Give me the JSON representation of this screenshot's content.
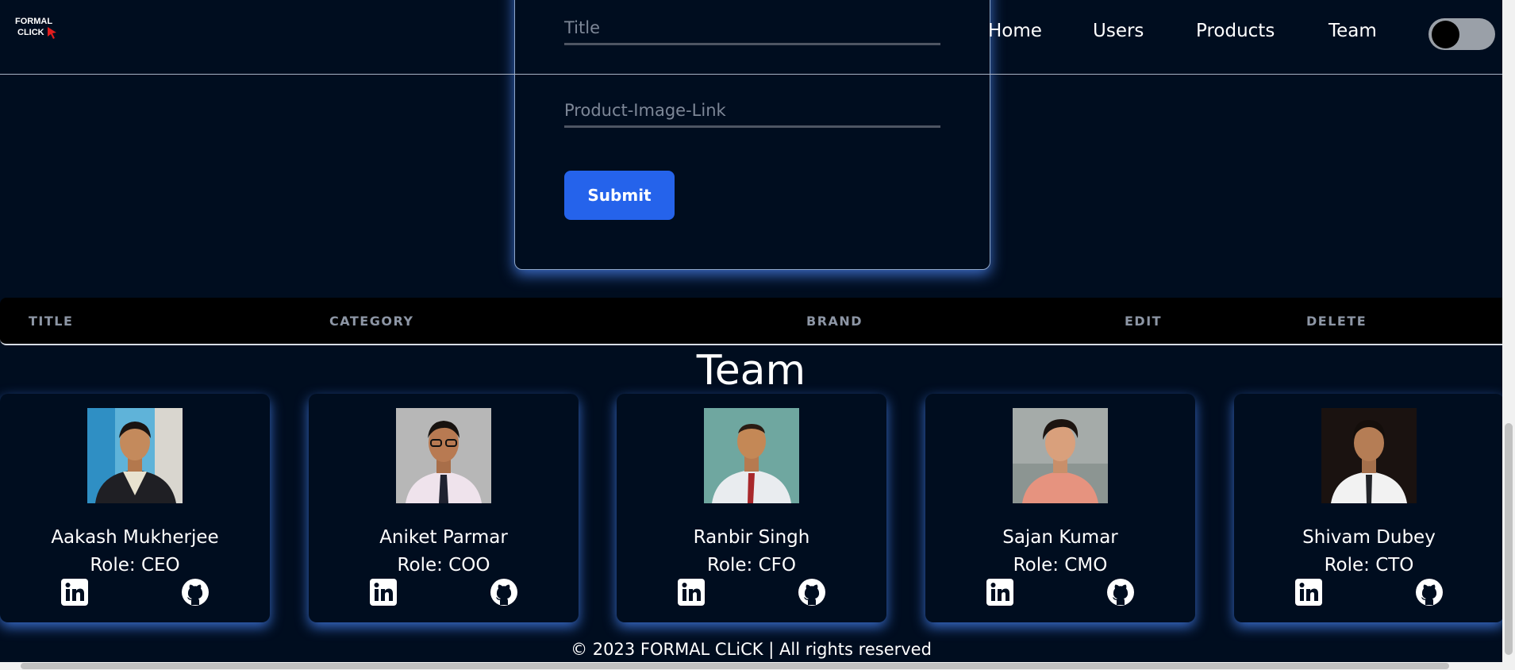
{
  "header": {
    "logo_line1": "FORMAL",
    "logo_line2": "CLICK",
    "nav": [
      {
        "label": "Home"
      },
      {
        "label": "Users"
      },
      {
        "label": "Products"
      },
      {
        "label": "Team"
      }
    ],
    "theme_toggle": {
      "state": "off"
    }
  },
  "form": {
    "title_placeholder": "Title",
    "image_placeholder": "Product-Image-Link",
    "submit_label": "Submit"
  },
  "table": {
    "columns": [
      "TITLE",
      "CATEGORY",
      "BRAND",
      "EDIT",
      "DELETE"
    ]
  },
  "team": {
    "heading": "Team",
    "members": [
      {
        "name": "Aakash Mukherjee",
        "role": "Role: CEO"
      },
      {
        "name": "Aniket Parmar",
        "role": "Role: COO"
      },
      {
        "name": "Ranbir Singh",
        "role": "Role: CFO"
      },
      {
        "name": "Sajan Kumar",
        "role": "Role: CMO"
      },
      {
        "name": "Shivam Dubey",
        "role": "Role: CTO"
      }
    ]
  },
  "footer": {
    "text": "© 2023 FORMAL CLiCK | All rights reserved"
  },
  "colors": {
    "background": "#000d1f",
    "accent": "#2563eb",
    "glow": "#4682f0"
  },
  "icons": [
    "cursor-icon",
    "linkedin-icon",
    "github-icon"
  ]
}
